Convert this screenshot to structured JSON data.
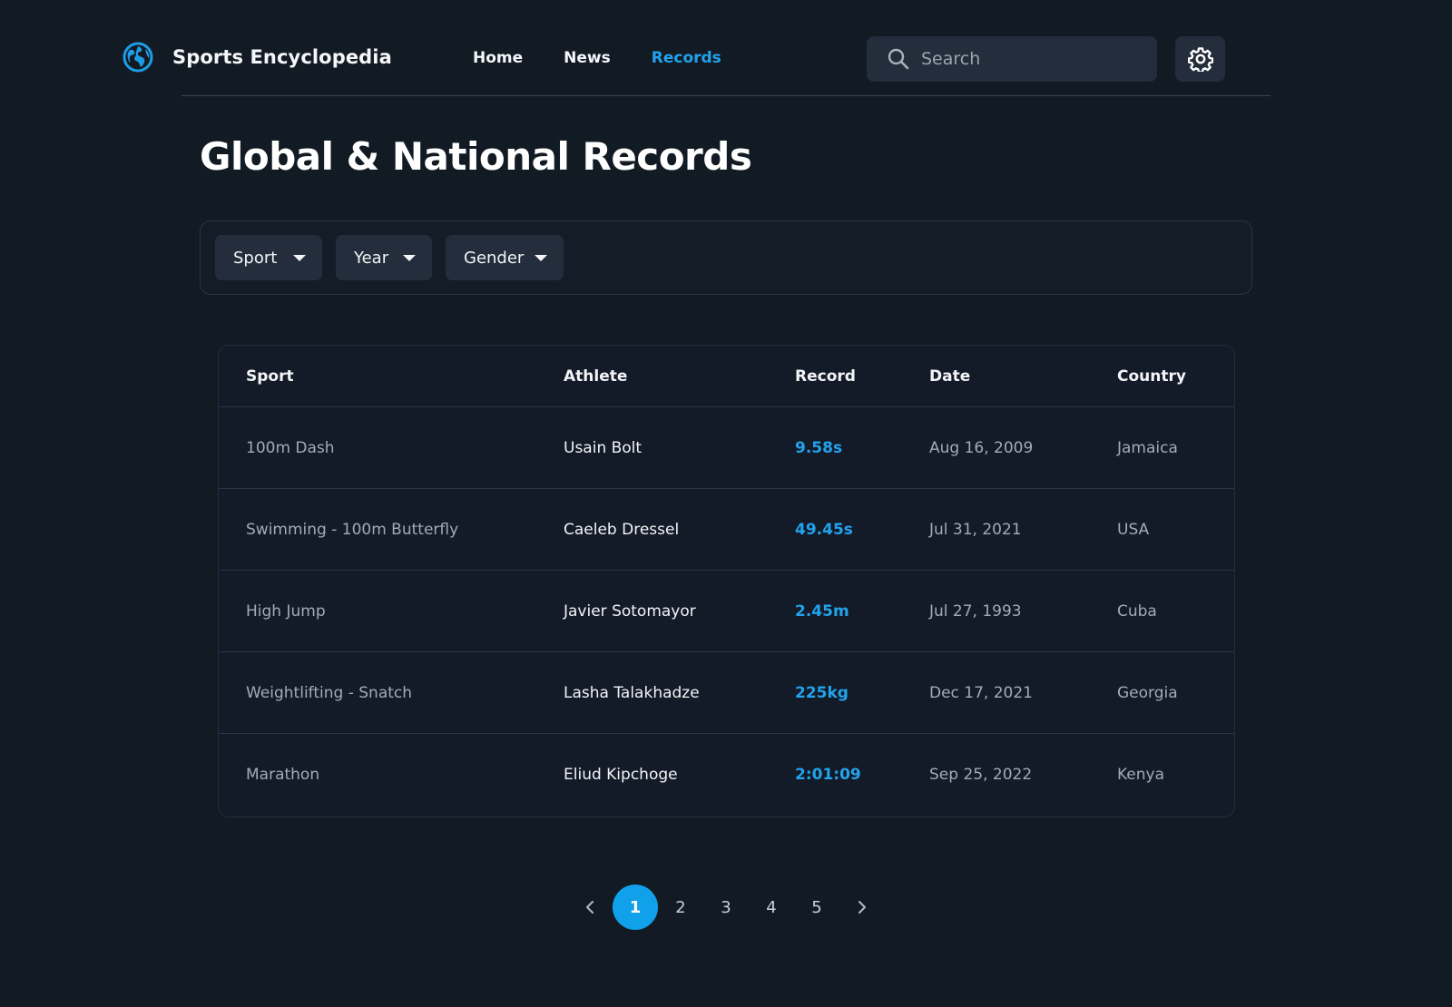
{
  "header": {
    "brand_name": "Sports Encyclopedia",
    "nav": [
      {
        "label": "Home",
        "active": false
      },
      {
        "label": "News",
        "active": false
      },
      {
        "label": "Records",
        "active": true
      }
    ],
    "search_placeholder": "Search",
    "brand_icon": "globe-icon",
    "settings_icon": "gear-icon"
  },
  "page": {
    "title": "Global & National Records"
  },
  "filters": [
    {
      "label": "Sport"
    },
    {
      "label": "Year"
    },
    {
      "label": "Gender"
    }
  ],
  "table": {
    "columns": [
      "Sport",
      "Athlete",
      "Record",
      "Date",
      "Country"
    ],
    "rows": [
      {
        "sport": "100m Dash",
        "athlete": "Usain Bolt",
        "record": "9.58s",
        "date": "Aug 16, 2009",
        "country": "Jamaica"
      },
      {
        "sport": "Swimming - 100m Butterfly",
        "athlete": "Caeleb Dressel",
        "record": "49.45s",
        "date": "Jul 31, 2021",
        "country": "USA"
      },
      {
        "sport": "High Jump",
        "athlete": "Javier Sotomayor",
        "record": "2.45m",
        "date": "Jul 27, 1993",
        "country": "Cuba"
      },
      {
        "sport": "Weightlifting - Snatch",
        "athlete": "Lasha Talakhadze",
        "record": "225kg",
        "date": "Dec 17, 2021",
        "country": "Georgia"
      },
      {
        "sport": "Marathon",
        "athlete": "Eliud Kipchoge",
        "record": "2:01:09",
        "date": "Sep 25, 2022",
        "country": "Kenya"
      }
    ]
  },
  "pagination": {
    "pages": [
      "1",
      "2",
      "3",
      "4",
      "5"
    ],
    "current": "1"
  },
  "colors": {
    "background": "#121b24",
    "accent": "#22a3ec",
    "surface": "#232d3b"
  }
}
